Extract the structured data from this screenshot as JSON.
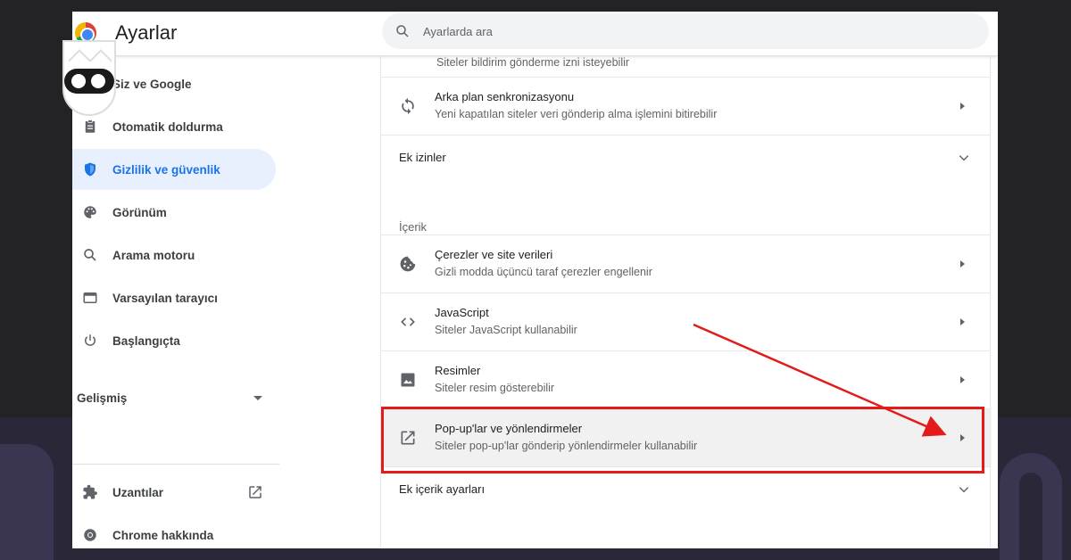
{
  "header": {
    "title": "Ayarlar",
    "search_placeholder": "Ayarlarda ara"
  },
  "sidebar": {
    "items": [
      {
        "label": "Siz ve Google",
        "icon": "person-icon"
      },
      {
        "label": "Otomatik doldurma",
        "icon": "clipboard-icon"
      },
      {
        "label": "Gizlilik ve güvenlik",
        "icon": "shield-icon",
        "active": true
      },
      {
        "label": "Görünüm",
        "icon": "palette-icon"
      },
      {
        "label": "Arama motoru",
        "icon": "search-icon"
      },
      {
        "label": "Varsayılan tarayıcı",
        "icon": "browser-window-icon"
      },
      {
        "label": "Başlangıçta",
        "icon": "power-icon"
      }
    ],
    "advanced_label": "Gelişmiş",
    "extensions_label": "Uzantılar",
    "about_label": "Chrome hakkında"
  },
  "main": {
    "cutoff_text": "Siteler bildirim gönderme izni isteyebilir",
    "background_sync": {
      "title": "Arka plan senkronizasyonu",
      "subtitle": "Yeni kapatılan siteler veri gönderip alma işlemini bitirebilir"
    },
    "extra_permissions_label": "Ek izinler",
    "content_heading": "İçerik",
    "rows": [
      {
        "title": "Çerezler ve site verileri",
        "subtitle": "Gizli modda üçüncü taraf çerezler engellenir",
        "icon": "cookie-icon"
      },
      {
        "title": "JavaScript",
        "subtitle": "Siteler JavaScript kullanabilir",
        "icon": "code-icon"
      },
      {
        "title": "Resimler",
        "subtitle": "Siteler resim gösterebilir",
        "icon": "image-icon"
      },
      {
        "title": "Pop-up'lar ve yönlendirmeler",
        "subtitle": "Siteler pop-up'lar gönderip yönlendirmeler kullanabilir",
        "icon": "open-in-new-icon",
        "highlighted": true
      }
    ],
    "extra_content_label": "Ek içerik ayarları"
  },
  "colors": {
    "accent": "#1a73e8",
    "active_bg": "#e8f0fe",
    "annotation_red": "#e31b1b",
    "background": "#232326"
  }
}
